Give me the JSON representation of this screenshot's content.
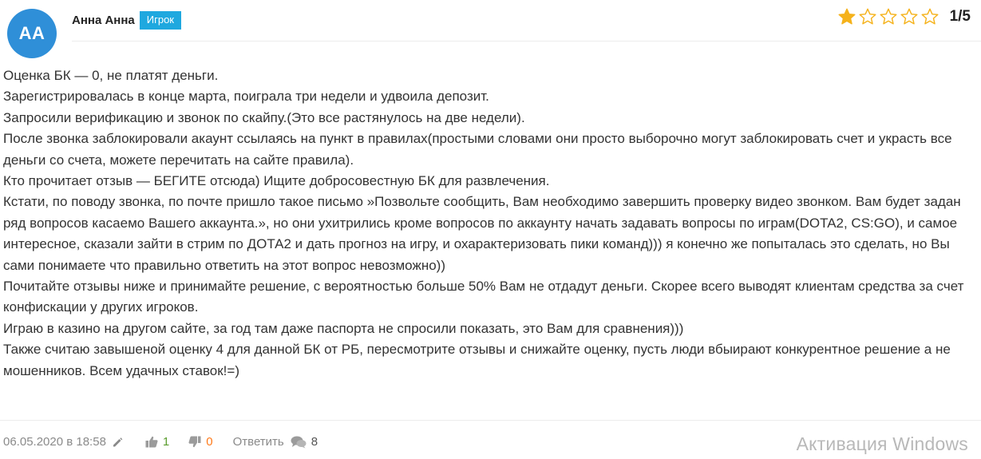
{
  "author": {
    "initials": "АА",
    "name": "Анна Анна",
    "role": "Игрок"
  },
  "rating": {
    "score_text": "1/5",
    "value": 1,
    "max": 5,
    "star_color": "#f5b21b",
    "star_outline_color": "#f5b21b"
  },
  "review": {
    "paragraphs": [
      "Оценка БК — 0, не платят деньги.",
      "Зарегистрировалась в конце марта, поиграла три недели и удвоила депозит.",
      "Запросили верификацию и звонок по скайпу.(Это все растянулось на две недели).",
      "После звонка заблокировали акаунт ссылаясь на пункт в правилах(простыми словами они просто выборочно могут заблокировать счет и украсть все деньги со счета, можете перечитать на сайте правила).",
      "Кто прочитает отзыв — БЕГИТЕ отсюда) Ищите добросовестную БК для развлечения.",
      "Кстати, по поводу звонка, по почте пришло такое письмо »Позвольте сообщить, Вам необходимо завершить проверку видео звонком. Вам будет задан ряд вопросов касаемо Вашего аккаунта.», но они ухитрились кроме вопросов по аккаунту начать задавать вопросы по играм(DOTA2, CS:GO), и самое интересное, сказали зайти в стрим по ДОТА2 и дать прогноз на игру, и охарактеризовать пики команд))) я конечно же попыталась это сделать, но Вы сами понимаете что правильно ответить на этот вопрос невозможно))",
      "Почитайте отзывы ниже и принимайте решение, с вероятностью больше 50% Вам не отдадут деньги. Скорее всего выводят клиентам средства за счет конфискации у других игроков.",
      "Играю в казино на другом сайте, за год там даже паспорта не спросили показать, это Вам для сравнения)))",
      "Также считаю завышеной оценку 4 для данной БК от РБ, пересмотрите отзывы и снижайте оценку, пусть люди вбыирают конкурентное решение а не мошенников. Всем удачных ставок!=)"
    ]
  },
  "footer": {
    "date": "06.05.2020 в 18:58",
    "likes": "1",
    "dislikes": "0",
    "reply_label": "Ответить",
    "comments": "8",
    "icons": {
      "edit": "pencil-icon",
      "like": "thumbs-up-icon",
      "dislike": "thumbs-down-icon",
      "comments": "chat-bubbles-icon"
    }
  },
  "watermark": "Активация Windows"
}
